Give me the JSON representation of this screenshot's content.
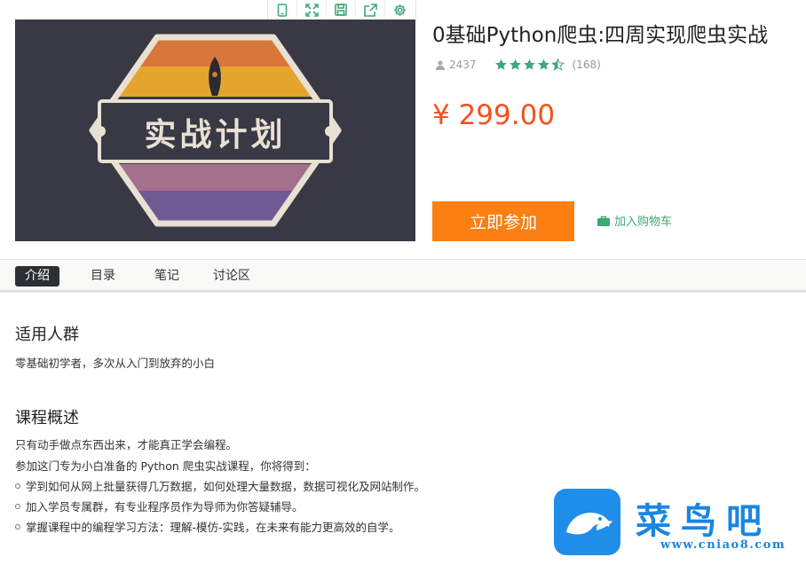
{
  "course": {
    "title": "0基础Python爬虫:四周实现爬虫实战",
    "learner_count": "2437",
    "rating": 4.5,
    "review_count": "(168)",
    "price": "¥ 299.00",
    "join_label": "立即参加",
    "cart_label": "加入购物车",
    "cover_text": "实战计划"
  },
  "toolbar": {
    "icons": [
      "mobile-icon",
      "fullscreen-icon",
      "save-icon",
      "share-icon",
      "settings-icon"
    ]
  },
  "tabs": [
    "介绍",
    "目录",
    "笔记",
    "讨论区"
  ],
  "active_tab": 0,
  "sections": {
    "audience_title": "适用人群",
    "audience_text": "零基础初学者，多次从入门到放弃的小白",
    "overview_title": "课程概述",
    "overview_lines": [
      "只有动手做点东西出来，才能真正学会编程。",
      "参加这门专为小白准备的 Python 爬虫实战课程，你将得到："
    ],
    "bullets": [
      "学到如何从网上批量获得几万数据，如何处理大量数据，数据可视化及网站制作。",
      "加入学员专属群，有专业程序员作为导师为你答疑辅导。",
      "掌握课程中的编程学习方法：理解-模仿-实践，在未来有能力更高效的自学。"
    ]
  },
  "watermark": {
    "name": "菜鸟吧",
    "url": "www.cniao8.com"
  },
  "colors": {
    "accent_orange": "#fb7f12",
    "price_red": "#f4511e",
    "star_green": "#3fa876",
    "brand_blue": "#1a86e0"
  }
}
